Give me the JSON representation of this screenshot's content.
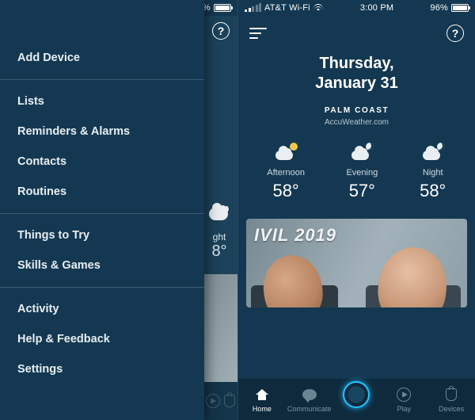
{
  "status": {
    "carrier": "AT&T Wi-Fi",
    "time": "3:00 PM",
    "battery_pct": "96%"
  },
  "drawer": {
    "groups": [
      [
        "Add Device"
      ],
      [
        "Lists",
        "Reminders & Alarms",
        "Contacts",
        "Routines"
      ],
      [
        "Things to Try",
        "Skills & Games"
      ],
      [
        "Activity",
        "Help & Feedback",
        "Settings"
      ]
    ]
  },
  "home": {
    "date_line1": "Thursday,",
    "date_line2": "January 31",
    "location": "PALM COAST",
    "weather_source": "AccuWeather.com",
    "forecast": [
      {
        "label": "Afternoon",
        "temp": "58°",
        "icon": "sun-cloud"
      },
      {
        "label": "Evening",
        "temp": "57°",
        "icon": "moon-cloud"
      },
      {
        "label": "Night",
        "temp": "58°",
        "icon": "moon-cloud"
      }
    ],
    "feed_card_text_part1": "IVIL",
    "feed_card_text_part2": "2019"
  },
  "left_peek": {
    "label": "ght",
    "temp": "8°"
  },
  "bottom_nav": [
    {
      "label": "Home"
    },
    {
      "label": "Communicate"
    },
    {
      "label": ""
    },
    {
      "label": "Play"
    },
    {
      "label": "Devices"
    }
  ]
}
